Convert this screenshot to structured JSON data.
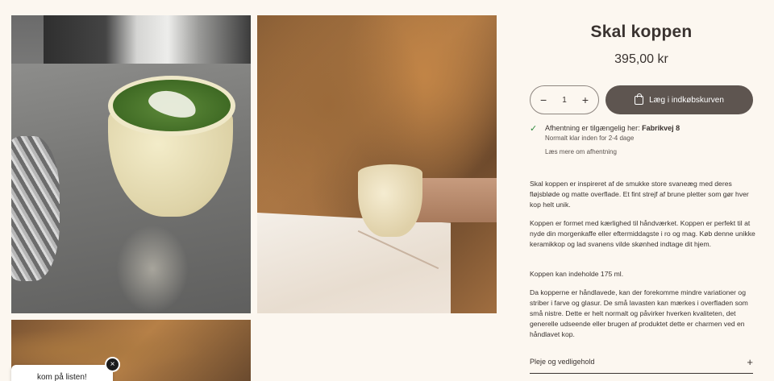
{
  "product": {
    "title": "Skal koppen",
    "price": "395,00 kr"
  },
  "quantity": {
    "minus": "−",
    "value": "1",
    "plus": "+"
  },
  "cart_button": {
    "label": "Læg i indkøbskurven",
    "icon": "bag-icon"
  },
  "pickup": {
    "text": "Afhentning er tilgængelig her: ",
    "location": "Fabrikvej 8",
    "eta": "Normalt klar inden for 2-4 dage",
    "link": "Læs mere om afhentning",
    "status_color": "#2e8a3e"
  },
  "description": [
    "Skal koppen er inspireret af de smukke store svaneæg med deres fløjsbløde og matte overflade. Et fint strejf af brune pletter som gør hver kop helt unik.",
    "Koppen er formet med kærlighed til håndværket. Koppen er perfekt til at nyde din morgenkaffe eller eftermiddagste i ro og mag. Køb denne unikke keramikkop og lad svanens vilde skønhed indtage dit hjem.",
    "Koppen kan indeholde 175 ml.",
    "Da kopperne er håndlavede, kan der forekomme mindre variationer og striber i farve og glasur. De små lavasten kan mærkes i overfladen som små nistre. Dette er helt normalt og påvirker hverken kvaliteten, det generelle udseende eller brugen af produktet dette er charmen ved en håndlavet kop."
  ],
  "accordion": {
    "label": "Pleje og vedligehold",
    "icon": "+"
  },
  "wishlist": {
    "label": "kom på listen!",
    "close": "×"
  },
  "colors": {
    "background": "#fcf7f0",
    "button": "#5e5550",
    "text": "#3a3330"
  }
}
